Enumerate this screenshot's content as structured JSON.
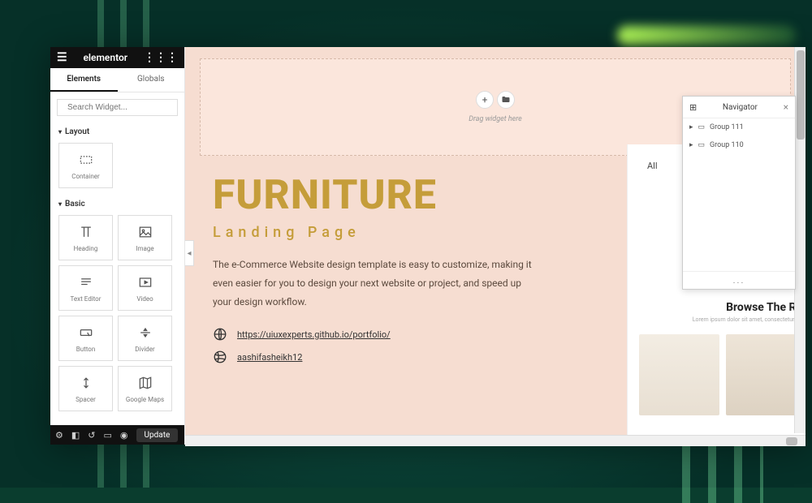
{
  "sidebar": {
    "brand": "elementor",
    "tabs": {
      "elements": "Elements",
      "globals": "Globals"
    },
    "search_placeholder": "Search Widget...",
    "sections": {
      "layout": {
        "title": "Layout",
        "items": [
          {
            "label": "Container"
          }
        ]
      },
      "basic": {
        "title": "Basic",
        "items": [
          {
            "label": "Heading"
          },
          {
            "label": "Image"
          },
          {
            "label": "Text Editor"
          },
          {
            "label": "Video"
          },
          {
            "label": "Button"
          },
          {
            "label": "Divider"
          },
          {
            "label": "Spacer"
          },
          {
            "label": "Google Maps"
          }
        ]
      }
    },
    "footer": {
      "update": "Update"
    }
  },
  "canvas": {
    "dropzone_hint": "Drag widget here",
    "hero": {
      "title": "FURNITURE",
      "subtitle": "Landing Page",
      "body": "The e-Commerce Website design template is easy to customize, making it even easier for you to design your next website or project, and speed up your design workflow.",
      "link1": "https://uiuxexperts.github.io/portfolio/",
      "link2": "aashifasheikh12"
    },
    "preview": {
      "nav_all": "All",
      "browse_title": "Browse The Ra",
      "browse_desc": "Lorem ipsum dolor sit amet, consectetur ad"
    }
  },
  "navigator": {
    "title": "Navigator",
    "items": [
      {
        "label": "Group 111"
      },
      {
        "label": "Group 110"
      }
    ],
    "footer": "..."
  }
}
